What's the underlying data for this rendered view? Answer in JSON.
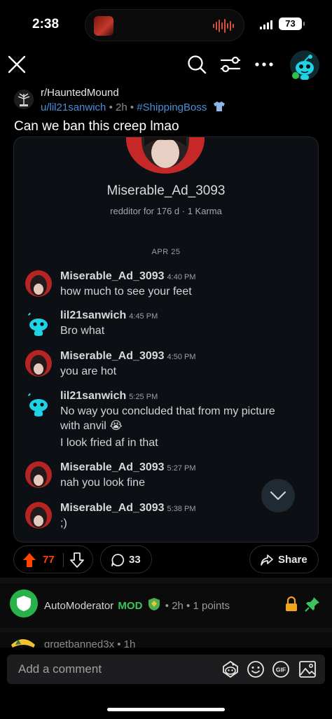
{
  "status_bar": {
    "time": "2:38",
    "battery": "73"
  },
  "header": {
    "icons": [
      "close-icon",
      "search-icon",
      "filter-icon",
      "more-icon",
      "avatar"
    ]
  },
  "post": {
    "subreddit": "r/HauntedMound",
    "author": "u/lil21sanwich",
    "age": "2h",
    "flair": "#ShippingBoss",
    "title": "Can we ban this creep lmao",
    "separator": "•"
  },
  "screenshot": {
    "profile_name": "Miserable_Ad_3093",
    "profile_meta": "redditor for 176 d · 1 Karma",
    "date": "APR 25",
    "messages": [
      {
        "user": "Miserable_Ad_3093",
        "time": "4:40 PM",
        "lines": [
          "how much to see your feet"
        ]
      },
      {
        "user": "lil21sanwich",
        "time": "4:45 PM",
        "lines": [
          "Bro what"
        ]
      },
      {
        "user": "Miserable_Ad_3093",
        "time": "4:50 PM",
        "lines": [
          "you are hot"
        ]
      },
      {
        "user": "lil21sanwich",
        "time": "5:25 PM",
        "lines": [
          "No way you concluded that from my picture",
          "with anvil 😭",
          "I look fried af in that"
        ]
      },
      {
        "user": "Miserable_Ad_3093",
        "time": "5:27 PM",
        "lines": [
          "nah you look fine"
        ]
      },
      {
        "user": "Miserable_Ad_3093",
        "time": "5:38 PM",
        "lines": [
          ";)"
        ]
      }
    ]
  },
  "actions": {
    "upvotes": "77",
    "comments": "33",
    "share_label": "Share"
  },
  "automod": {
    "name": "AutoModerator",
    "role": "MOD",
    "age": "2h",
    "points": "1 points"
  },
  "next_comment": {
    "text": "grgetbanned3x • 1h"
  },
  "composer": {
    "placeholder": "Add a comment",
    "gif_label": "GIF"
  },
  "colors": {
    "upvote": "#ff4500",
    "link": "#4a8fd8",
    "mod_green": "#3ac45c",
    "snoo_cyan": "#1fd3e6"
  }
}
